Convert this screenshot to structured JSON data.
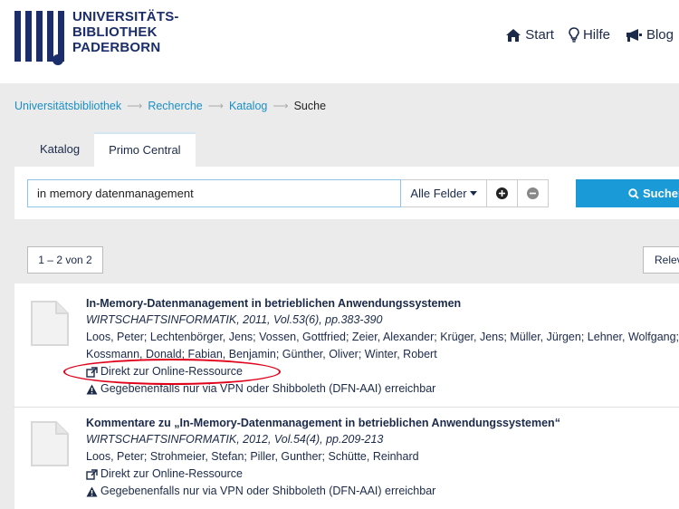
{
  "header": {
    "logo_lines": [
      "UNIVERSITÄTS-",
      "BIBLIOTHEK",
      "PADERBORN"
    ],
    "nav": [
      {
        "label": "Start",
        "icon": "home-icon"
      },
      {
        "label": "Hilfe",
        "icon": "lightbulb-icon"
      },
      {
        "label": "Blog",
        "icon": "megaphone-icon"
      }
    ]
  },
  "breadcrumb": {
    "items": [
      "Universitätsbibliothek",
      "Recherche",
      "Katalog"
    ],
    "current": "Suche"
  },
  "tabs": [
    {
      "label": "Katalog",
      "active": false
    },
    {
      "label": "Primo Central",
      "active": true
    }
  ],
  "search": {
    "value": "in memory datenmanagement",
    "field": "Alle Felder",
    "button": "Suchen"
  },
  "results_bar": {
    "count": "1 – 2 von 2",
    "sort": "Relevanz"
  },
  "results": [
    {
      "title": "In-Memory-Datenmanagement in betrieblichen Anwendungssystemen",
      "source": "WIRTSCHAFTSINFORMATIK, 2011, Vol.53(6), pp.383-390",
      "authors_line1": "Loos, Peter; Lechtenbörger, Jens; Vossen, Gottfried; Zeier, Alexander; Krüger, Jens; Müller, Jürgen; Lehner, Wolfgang;",
      "authors_line2": "Kossmann, Donald; Fabian, Benjamin; Günther, Oliver; Winter, Robert",
      "link": "Direkt zur Online-Ressource",
      "warning": "Gegebenenfalls nur via VPN oder Shibboleth (DFN-AAI) erreichbar"
    },
    {
      "title": "Kommentare zu „In-Memory-Datenmanagement in betrieblichen Anwendungssystemen“",
      "source": "WIRTSCHAFTSINFORMATIK, 2012, Vol.54(4), pp.209-213",
      "authors_line1": "Loos, Peter; Strohmeier, Stefan; Piller, Gunther; Schütte, Reinhard",
      "link": "Direkt zur Online-Ressource",
      "warning": "Gegebenenfalls nur via VPN oder Shibboleth (DFN-AAI) erreichbar"
    }
  ],
  "colors": {
    "brand": "#1b2e6b",
    "link": "#1a8fc7",
    "search_button": "#1a9bd7",
    "highlight": "#e0001a"
  }
}
